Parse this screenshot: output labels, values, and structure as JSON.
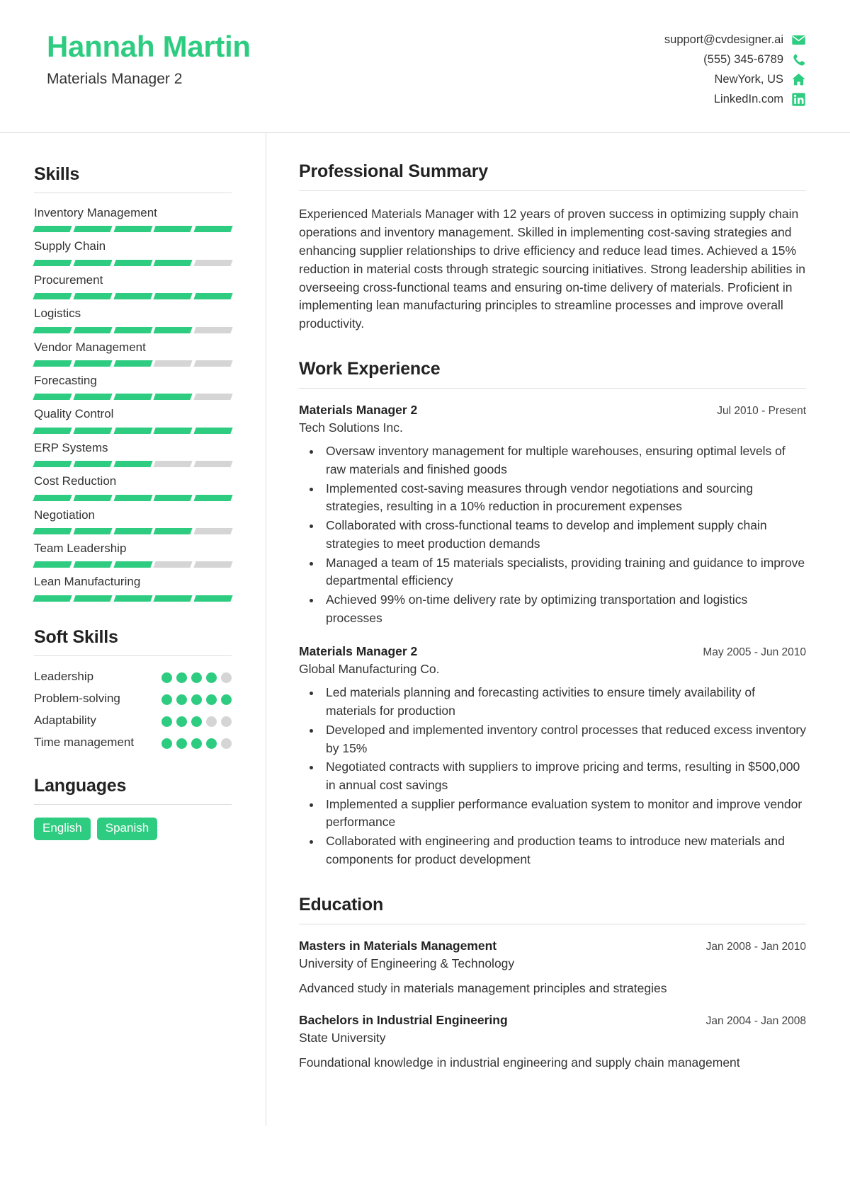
{
  "theme": {
    "accent": "#2ECC80",
    "muted": "#d5d5d5",
    "text": "#333333",
    "rule": "#dddddd"
  },
  "header": {
    "name": "Hannah Martin",
    "title": "Materials Manager 2",
    "contacts": [
      {
        "icon": "envelope-icon",
        "value": "support@cvdesigner.ai"
      },
      {
        "icon": "phone-icon",
        "value": "(555) 345-6789"
      },
      {
        "icon": "home-icon",
        "value": "NewYork, US"
      },
      {
        "icon": "linkedin-icon",
        "value": "LinkedIn.com"
      }
    ]
  },
  "sidebar": {
    "skills_heading": "Skills",
    "skills": [
      {
        "name": "Inventory Management",
        "level": 5,
        "max": 5
      },
      {
        "name": "Supply Chain",
        "level": 4,
        "max": 5
      },
      {
        "name": "Procurement",
        "level": 5,
        "max": 5
      },
      {
        "name": "Logistics",
        "level": 4,
        "max": 5
      },
      {
        "name": "Vendor Management",
        "level": 3,
        "max": 5
      },
      {
        "name": "Forecasting",
        "level": 4,
        "max": 5
      },
      {
        "name": "Quality Control",
        "level": 5,
        "max": 5
      },
      {
        "name": "ERP Systems",
        "level": 3,
        "max": 5
      },
      {
        "name": "Cost Reduction",
        "level": 5,
        "max": 5
      },
      {
        "name": "Negotiation",
        "level": 4,
        "max": 5
      },
      {
        "name": "Team Leadership",
        "level": 3,
        "max": 5
      },
      {
        "name": "Lean Manufacturing",
        "level": 5,
        "max": 5
      }
    ],
    "soft_skills_heading": "Soft Skills",
    "soft_skills": [
      {
        "name": "Leadership",
        "level": 4,
        "max": 5
      },
      {
        "name": "Problem-solving",
        "level": 5,
        "max": 5
      },
      {
        "name": "Adaptability",
        "level": 3,
        "max": 5
      },
      {
        "name": "Time management",
        "level": 4,
        "max": 5
      }
    ],
    "languages_heading": "Languages",
    "languages": [
      "English",
      "Spanish"
    ]
  },
  "main": {
    "summary_heading": "Professional Summary",
    "summary_text": "Experienced Materials Manager with 12 years of proven success in optimizing supply chain operations and inventory management. Skilled in implementing cost-saving strategies and enhancing supplier relationships to drive efficiency and reduce lead times. Achieved a 15% reduction in material costs through strategic sourcing initiatives. Strong leadership abilities in overseeing cross-functional teams and ensuring on-time delivery of materials. Proficient in implementing lean manufacturing principles to streamline processes and improve overall productivity.",
    "experience_heading": "Work Experience",
    "experience": [
      {
        "role": "Materials Manager 2",
        "company": "Tech Solutions Inc.",
        "date": "Jul 2010 - Present",
        "bullets": [
          "Oversaw inventory management for multiple warehouses, ensuring optimal levels of raw materials and finished goods",
          "Implemented cost-saving measures through vendor negotiations and sourcing strategies, resulting in a 10% reduction in procurement expenses",
          "Collaborated with cross-functional teams to develop and implement supply chain strategies to meet production demands",
          "Managed a team of 15 materials specialists, providing training and guidance to improve departmental efficiency",
          "Achieved 99% on-time delivery rate by optimizing transportation and logistics processes"
        ]
      },
      {
        "role": "Materials Manager 2",
        "company": "Global Manufacturing Co.",
        "date": "May 2005 - Jun 2010",
        "bullets": [
          "Led materials planning and forecasting activities to ensure timely availability of materials for production",
          "Developed and implemented inventory control processes that reduced excess inventory by 15%",
          "Negotiated contracts with suppliers to improve pricing and terms, resulting in $500,000 in annual cost savings",
          "Implemented a supplier performance evaluation system to monitor and improve vendor performance",
          "Collaborated with engineering and production teams to introduce new materials and components for product development"
        ]
      }
    ],
    "education_heading": "Education",
    "education": [
      {
        "degree": "Masters in Materials Management",
        "school": "University of Engineering & Technology",
        "date": "Jan 2008 - Jan 2010",
        "description": "Advanced study in materials management principles and strategies"
      },
      {
        "degree": "Bachelors in Industrial Engineering",
        "school": "State University",
        "date": "Jan 2004 - Jan 2008",
        "description": "Foundational knowledge in industrial engineering and supply chain management"
      }
    ]
  }
}
